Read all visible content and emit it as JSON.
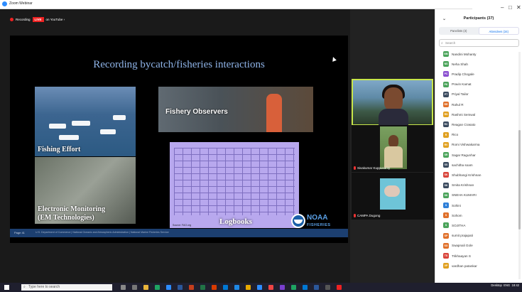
{
  "window": {
    "title": "Zoom Webinar",
    "controls": [
      "–",
      "□",
      "✕"
    ]
  },
  "recording": {
    "label": "Recording",
    "live": "LIVE",
    "platform": "on YouTube ›"
  },
  "slide": {
    "title": "Recording bycatch/fisheries interactions",
    "photos": {
      "effort": "Fishing Effort",
      "observers": "Fishery Observers",
      "monitoring_line1": "Electronic Monitoring",
      "monitoring_line2": "(EM Technologies)",
      "logbooks": "Logbooks",
      "source": "Source: FAO.org"
    },
    "footer_page": "Page 41",
    "footer_text": "U.S. Department of Commerce | National Oceanic and Atmospheric Administration | National Marine Fisheries Service",
    "logo_text": "NOAA",
    "logo_sub": "FISHERIES"
  },
  "thumbnails": [
    {
      "name": ""
    },
    {
      "name": "Sivakumar Kuppusamy"
    },
    {
      "name": "CAMPA Dugong"
    }
  ],
  "panel": {
    "title": "Participants (37)",
    "tabs": [
      "Panelists (3)",
      "Attendees (34)"
    ],
    "search_placeholder": "Search",
    "attendees": [
      {
        "initials": "NM",
        "name": "Nandini Mohanty",
        "color": "#4aa35a"
      },
      {
        "initials": "NS",
        "name": "Neha Shah",
        "color": "#4aa35a"
      },
      {
        "initials": "PC",
        "name": "Pradip Chogale",
        "color": "#8a4fd0"
      },
      {
        "initials": "PK",
        "name": "Pravin Kamat",
        "color": "#4aa35a"
      },
      {
        "initials": "PT",
        "name": "Priyal Tailor",
        "color": "#3a4a5e"
      },
      {
        "initials": "RR",
        "name": "Rahul R",
        "color": "#e0702a"
      },
      {
        "initials": "RS",
        "name": "Rashmi Semwal",
        "color": "#e0a020"
      },
      {
        "initials": "RC",
        "name": "Reagan Crasato",
        "color": "#3a4a5e"
      },
      {
        "initials": "R",
        "name": "Rico",
        "color": "#e0a020"
      },
      {
        "initials": "RV",
        "name": "Romi Vishwakarma",
        "color": "#e0a020"
      },
      {
        "initials": "SR",
        "name": "Sagar Ragunhar",
        "color": "#4aa35a"
      },
      {
        "initials": "SS",
        "name": "sachitha soam",
        "color": "#3a4a5e"
      },
      {
        "initials": "SK",
        "name": "Shubhangi Krishnan",
        "color": "#d9443a"
      },
      {
        "initials": "SK",
        "name": "Smita Krishnan",
        "color": "#3a4a5e"
      },
      {
        "initials": "SK",
        "name": "SNEHA KUMARI",
        "color": "#4aa35a"
      },
      {
        "initials": "S",
        "name": "Sohini",
        "color": "#2f7fd8"
      },
      {
        "initials": "S",
        "name": "Sohom",
        "color": "#e0702a"
      },
      {
        "initials": "S",
        "name": "SOJITHA",
        "color": "#4aa35a"
      },
      {
        "initials": "SP",
        "name": "sumit prajapati",
        "color": "#e0702a"
      },
      {
        "initials": "SG",
        "name": "Swapnali Gole",
        "color": "#e0702a"
      },
      {
        "initials": "TS",
        "name": "Trikhaayan S",
        "color": "#d9443a"
      },
      {
        "initials": "VP",
        "name": "vardhan patankar",
        "color": "#e0a020"
      }
    ]
  },
  "taskbar": {
    "search_placeholder": "Type here to search",
    "tray_label": "Desktop",
    "lang": "ENG",
    "time": "18:42",
    "date": ""
  }
}
